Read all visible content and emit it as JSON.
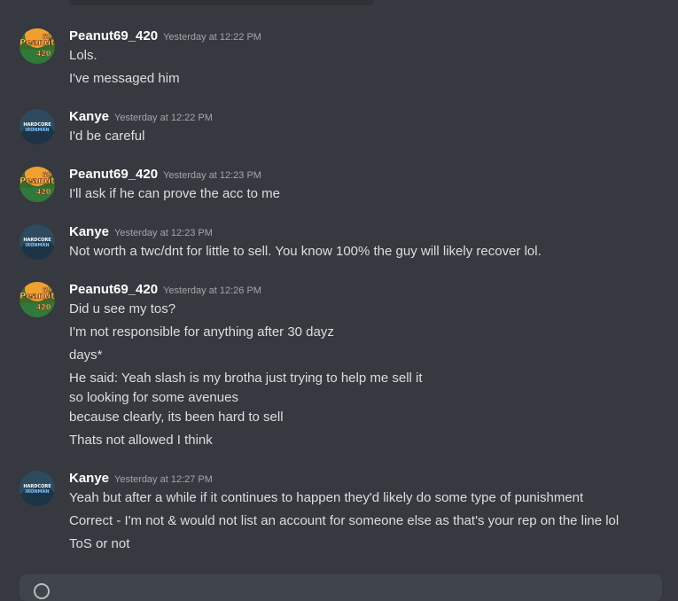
{
  "messages": [
    {
      "author": "Peanut69_420",
      "timestamp": "Yesterday at 12:22 PM",
      "avatar_badge": "Peanut 69 420",
      "lines": [
        "Lols.",
        "I've messaged him"
      ]
    },
    {
      "author": "Kanye",
      "timestamp": "Yesterday at 12:22 PM",
      "avatar_badge": "HARDCORE IRONMAN",
      "lines": [
        "I'd be careful"
      ]
    },
    {
      "author": "Peanut69_420",
      "timestamp": "Yesterday at 12:23 PM",
      "avatar_badge": "Peanut 69 420",
      "lines": [
        "I'll ask if he can prove the acc to me"
      ]
    },
    {
      "author": "Kanye",
      "timestamp": "Yesterday at 12:23 PM",
      "avatar_badge": "HARDCORE IRONMAN",
      "lines": [
        "Not worth a twc/dnt for little to sell. You know 100% the guy will likely recover lol."
      ]
    },
    {
      "author": "Peanut69_420",
      "timestamp": "Yesterday at 12:26 PM",
      "avatar_badge": "Peanut 69 420",
      "lines": [
        "Did u see my tos?",
        "I'm not responsible for anything after 30 dayz",
        "days*",
        "He said: Yeah slash is my brotha just trying to help me sell it",
        "so looking for some avenues",
        "because clearly, its been hard to sell",
        "Thats not allowed I think"
      ]
    },
    {
      "author": "Kanye",
      "timestamp": "Yesterday at 12:27 PM",
      "avatar_badge": "HARDCORE IRONMAN",
      "lines": [
        "Yeah but after a while if it continues to happen they'd likely do some type of punishment",
        "Correct - I'm not & would not list an account for someone else as that's your rep on the line lol",
        "ToS or not"
      ]
    }
  ],
  "colors": {
    "background": "#36393f",
    "username": "#ffffff",
    "timestamp": "#a3a6aa",
    "text": "#dcddde",
    "composer": "#40444b"
  },
  "icons": {
    "composer": "add-circle-icon"
  }
}
